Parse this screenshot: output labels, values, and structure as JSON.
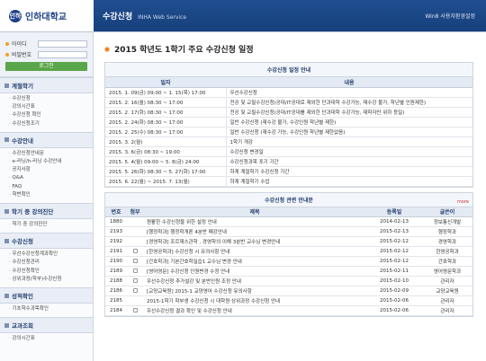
{
  "brand": {
    "logo": "인하",
    "name": "인하대학교"
  },
  "header": {
    "title": "수강신청",
    "subtitle": "INHA Web Service",
    "right": "Win8 사용자환경설정"
  },
  "login": {
    "id_label": "아이디",
    "pw_label": "비밀번호",
    "button": "로그인"
  },
  "sidebar": {
    "sections": [
      {
        "title": "계절학기",
        "items": [
          "수강신청",
          "강의시간표",
          "수강신청 확인",
          "수강신청조기"
        ]
      },
      {
        "title": "수강안내",
        "items": [
          "수강신청안내문",
          "e-러닝/h-러닝 수강안내",
          "공지사항",
          "Q&A",
          "FAQ",
          "학번확인"
        ]
      },
      {
        "title": "학기 중 강의진단",
        "items": [
          "학기 중 강의진단"
        ]
      },
      {
        "title": "수강신청",
        "items": [
          "우선수강신청계과확인",
          "수강신청관리",
          "수강신청확인",
          "상위과정(학부)수강신청"
        ]
      },
      {
        "title": "성적확인",
        "items": [
          "기초학수과목확인"
        ]
      },
      {
        "title": "교과조회",
        "items": [
          "강의시간표"
        ]
      }
    ]
  },
  "page": {
    "title": "2015 학년도 1학기 주요 수강신청 일정"
  },
  "schedule": {
    "caption": "수강신청 일정 안내",
    "headers": [
      "일자",
      "내용"
    ],
    "rows": [
      [
        "2015. 1. 09(금) 09:00 ~ 1. 15(목) 17:00",
        "우선수강신청"
      ],
      [
        "2015. 2. 16(월) 08:30 ~ 17:00",
        "전공 및 교필수강신청(공대/IT공대로 제외한 단과대학 수강가능, 재수강 불가, 학년별 인원제한)"
      ],
      [
        "2015. 2. 17(화) 08:30 ~ 17:00",
        "전공 및 교필수강신청(공대/IT공대를 제외한 단과대학 수강가능, 재학자만 위하 등일)"
      ],
      [
        "2015. 2. 24(화) 08:30 ~ 17:00",
        "일반 수강신청 (재수강 불가, 수강인원 학년별 제한)"
      ],
      [
        "2015. 2. 25(수) 08:30 ~ 17:00",
        "일반 수강신청 (재수강 가능, 수강인원 학년별 제한없음)"
      ],
      [
        "2015. 3. 2(월)",
        "1학기 개강"
      ],
      [
        "2015. 3. 6(금) 08:30 ~ 19:00",
        "수강신청 변경일"
      ],
      [
        "2015. 5. 4(월) 09:00 ~ 5. 8(금) 24:00",
        "수강신청과목 포기 기간"
      ],
      [
        "2015. 5. 26(화) 08:30 ~ 5. 27(화) 17:00",
        "하계 계절학기 수강신청 기간"
      ],
      [
        "2015. 6. 22(월) ~ 2015. 7. 13(월)",
        "하계 계절학기 수업"
      ]
    ]
  },
  "notices": {
    "caption": "수강신청 관련 안내문",
    "more": "more",
    "headers": [
      "번호",
      "첨부",
      "제목",
      "등록일",
      "글쓴이"
    ],
    "rows": [
      [
        "1880",
        "",
        "원활한 수강신청을 위한 설정 안내",
        "2014-02-13",
        "정보통신개발"
      ],
      [
        "2193",
        "",
        "[행정학과] 행정학개론 4분반 폐강안내",
        "2015-02-13",
        "행정학과"
      ],
      [
        "2192",
        "",
        "[경영학과] 조르재스관학 , 경영학의 이해 3분반 교수님 변경안내",
        "2015-02-12",
        "경영학과"
      ],
      [
        "2191",
        "clip",
        "[한영공학과] 수강신청 시 유의사항 안내",
        "2015-02-12",
        "한영공학과"
      ],
      [
        "2190",
        "clip",
        "[간호학과] 기본간호학실습1 교수님 변경 안내",
        "2015-02-12",
        "간호학과"
      ],
      [
        "2189",
        "clip",
        "[영어영문] 수강신청 인원변경 수정 안내",
        "2015-02-11",
        "영어영문학과"
      ],
      [
        "2188",
        "clip",
        "우선수강신청 추가설강 및 분반인원 조정 안내",
        "2015-02-10",
        "관리자"
      ],
      [
        "2186",
        "clip",
        "[교양교육원] 2015-1 교양영어 수강신청 유의사항",
        "2015-02-09",
        "교양교육원"
      ],
      [
        "2185",
        "",
        "2015-1학기 학부생 수강신청 시 대학원 상위과정 수강신청 안내",
        "2015-02-06",
        "관리자"
      ],
      [
        "2184",
        "clip",
        "우선수강신청 결과 확인 및 수강신청 안내",
        "2015-02-06",
        "관리자"
      ]
    ]
  }
}
